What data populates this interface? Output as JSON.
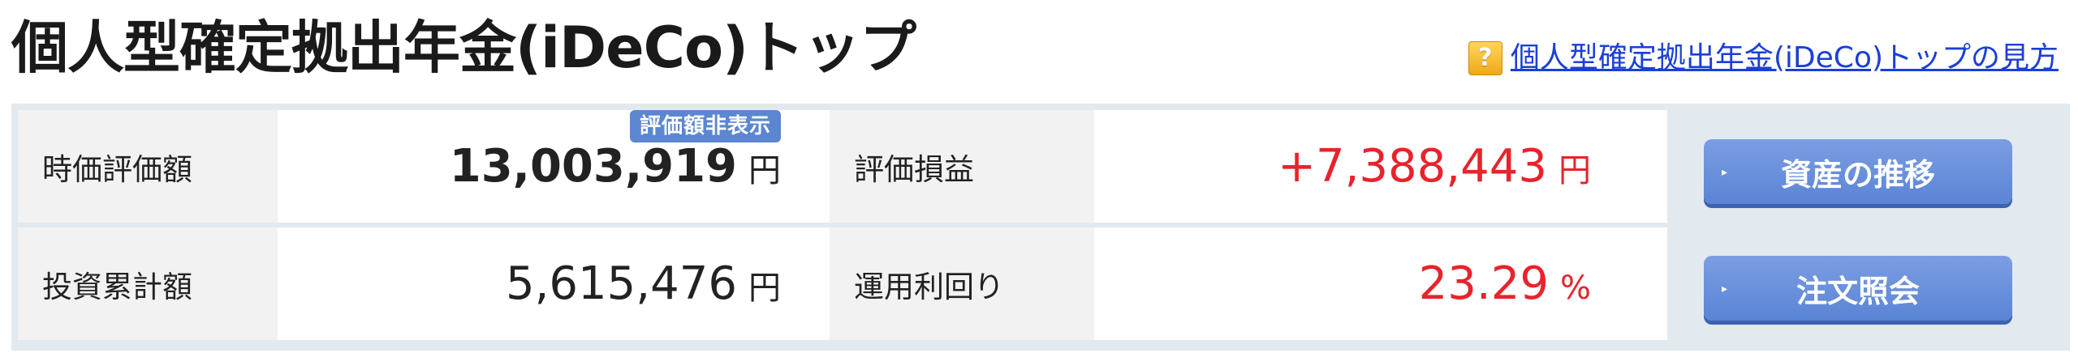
{
  "header": {
    "title": "個人型確定拠出年金(iDeCo)トップ",
    "help_icon_glyph": "?",
    "help_link_text": "個人型確定拠出年金(iDeCo)トップの見方"
  },
  "summary": {
    "market_value": {
      "label": "時価評価額",
      "value": "13,003,919",
      "unit": "円",
      "hide_badge": "評価額非表示"
    },
    "profit_loss": {
      "label": "評価損益",
      "value": "+7,388,443",
      "unit": "円"
    },
    "invested_total": {
      "label": "投資累計額",
      "value": "5,615,476",
      "unit": "円"
    },
    "yield": {
      "label": "運用利回り",
      "value": "23.29",
      "unit": "%"
    }
  },
  "buttons": {
    "asset_trend": "資産の推移",
    "order_inquiry": "注文照会",
    "arrow_glyph": "▸"
  },
  "colors": {
    "positive": "#e8232b",
    "button": "#5a84d5",
    "link": "#1b3fd6",
    "panel_bg": "#e2e9ef",
    "label_bg": "#f2f2f2"
  }
}
